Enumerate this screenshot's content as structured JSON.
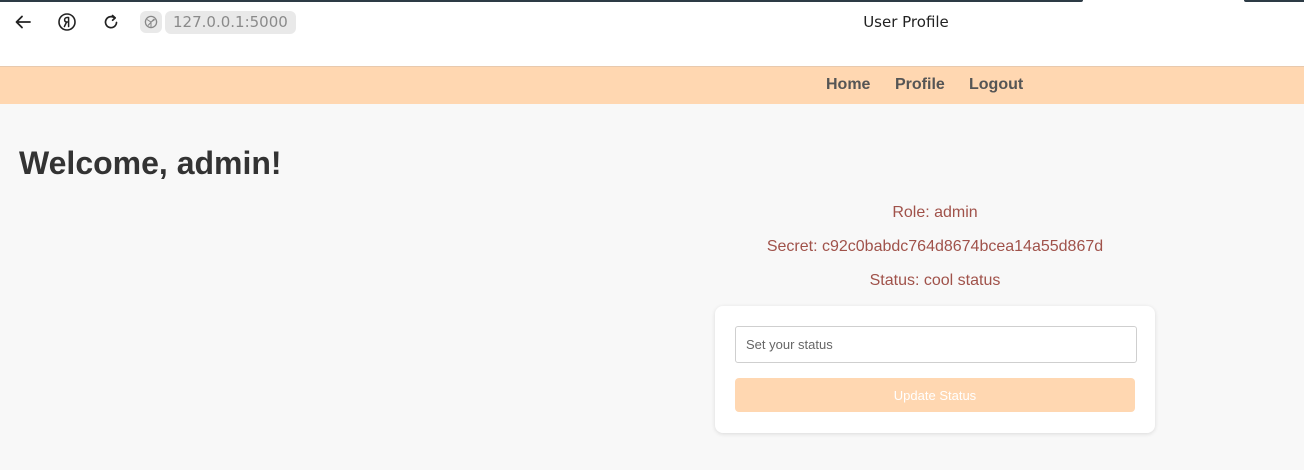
{
  "browser": {
    "url": "127.0.0.1:5000",
    "tab_title": "User Profile",
    "icons": {
      "back": "back-arrow-icon",
      "yandex": "yandex-logo-icon",
      "reload": "reload-icon",
      "site": "site-globe-icon"
    }
  },
  "navbar": {
    "links": [
      {
        "label": "Home"
      },
      {
        "label": "Profile"
      },
      {
        "label": "Logout"
      }
    ],
    "background": "#ffd7b1"
  },
  "main": {
    "welcome": "Welcome, admin!",
    "role": "Role: admin",
    "secret": "Secret: c92c0babdc764d8674bcea14a55d867d",
    "status": "Status: cool status",
    "status_input": {
      "value": "",
      "placeholder": "Set your status"
    },
    "update_button": "Update Status",
    "info_color": "#a0524a"
  }
}
